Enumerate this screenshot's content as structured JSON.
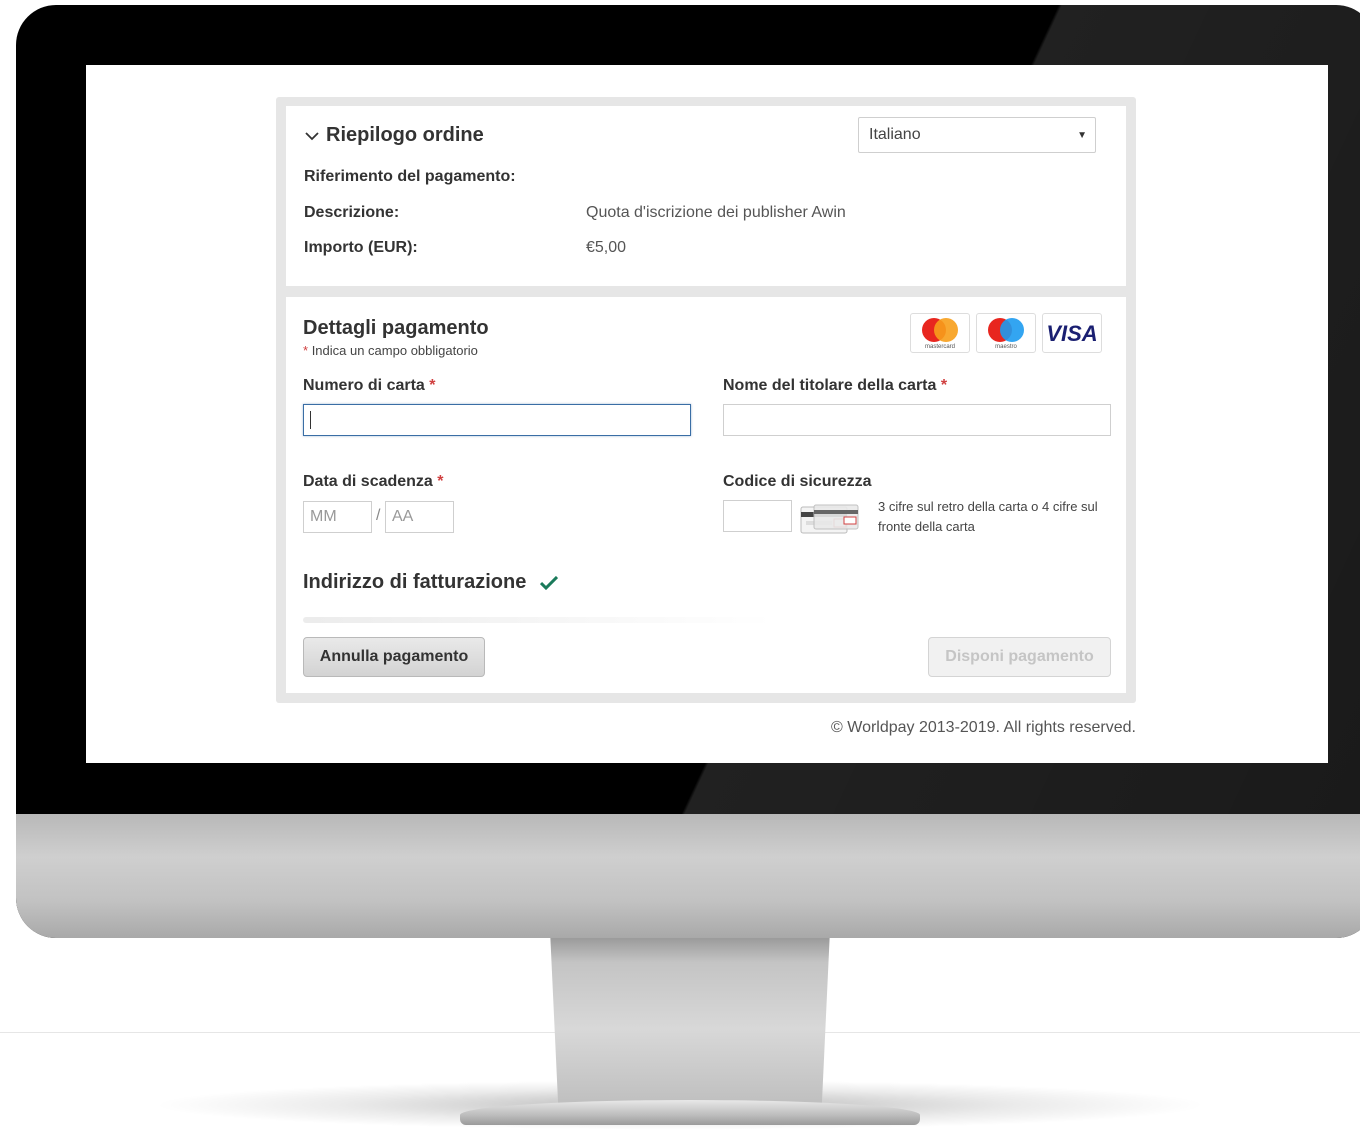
{
  "order_summary": {
    "title": "Riepilogo ordine",
    "language_selected": "Italiano",
    "rows": [
      {
        "label": "Riferimento del pagamento:",
        "value": ""
      },
      {
        "label": "Descrizione:",
        "value": "Quota d'iscrizione dei publisher Awin"
      },
      {
        "label": "Importo (EUR):",
        "value": "€5,00"
      }
    ]
  },
  "payment": {
    "title": "Dettagli pagamento",
    "required_marker": "*",
    "required_note": "Indica un campo obbligatorio",
    "card_logos": [
      {
        "name": "mastercard",
        "caption": "mastercard"
      },
      {
        "name": "maestro",
        "caption": "maestro"
      },
      {
        "name": "visa",
        "caption": "VISA"
      }
    ],
    "card_number_label": "Numero di carta",
    "card_number_value": "",
    "cardholder_label": "Nome del titolare della carta",
    "cardholder_value": "",
    "expiry_label": "Data di scadenza",
    "expiry_month_placeholder": "MM",
    "expiry_separator": "/",
    "expiry_year_placeholder": "AA",
    "security_code_label": "Codice di sicurezza",
    "security_code_hint": "3 cifre sul retro della carta o 4 cifre sul fronte della carta",
    "billing_title": "Indirizzo di fatturazione",
    "billing_status_icon": "check-icon",
    "cancel_label": "Annulla pagamento",
    "submit_label": "Disponi pagamento"
  },
  "footer": {
    "copyright": "© Worldpay 2013-2019. All rights reserved."
  },
  "colors": {
    "accent_check": "#1a7a5a",
    "required_star": "#d04040",
    "focus_border": "#3a6ea5"
  }
}
